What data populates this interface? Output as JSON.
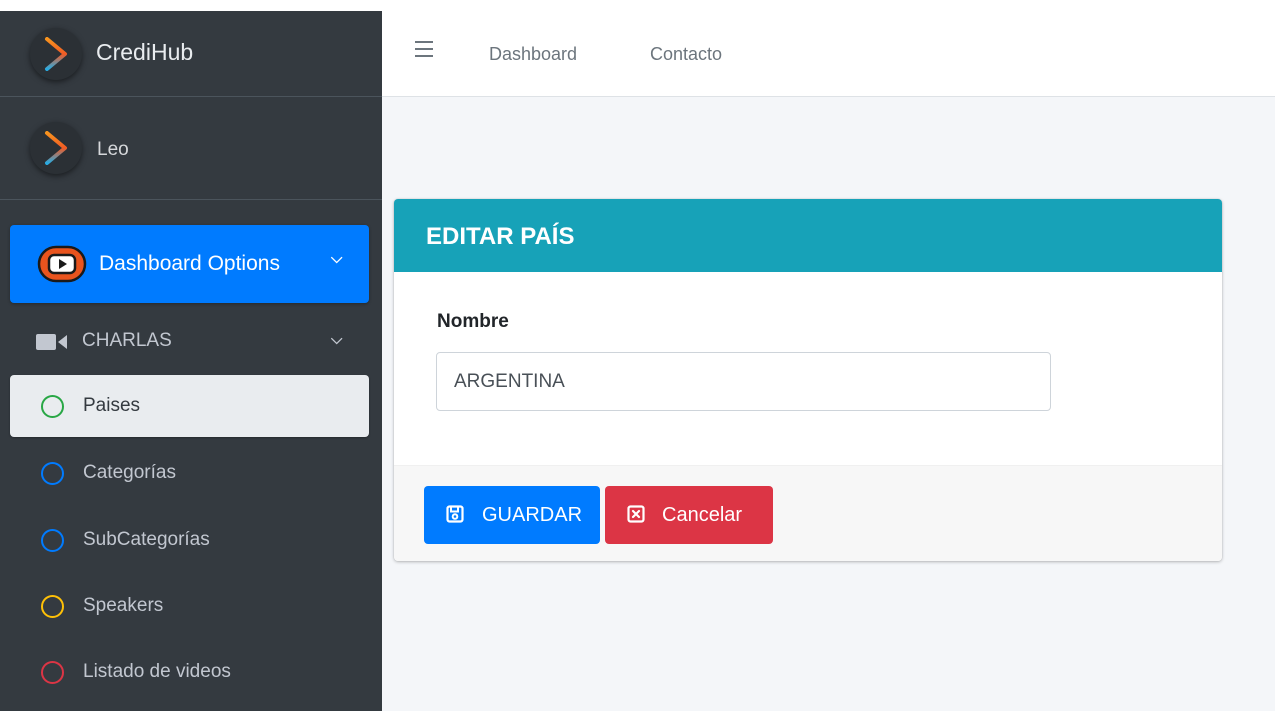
{
  "brand": {
    "name": "CrediHub",
    "logo_icon": "chevron-logo-icon"
  },
  "user": {
    "name": "Leo"
  },
  "sidebar": {
    "main_menu": {
      "label": "Dashboard Options",
      "icon": "youtube-icon"
    },
    "section": {
      "label": "CHARLAS",
      "icon": "video-camera-icon"
    },
    "items": [
      {
        "label": "Paises",
        "circle_color": "#28a745",
        "active": true
      },
      {
        "label": "Categorías",
        "circle_color": "#007bff",
        "active": false
      },
      {
        "label": "SubCategorías",
        "circle_color": "#007bff",
        "active": false
      },
      {
        "label": "Speakers",
        "circle_color": "#ffc107",
        "active": false
      },
      {
        "label": "Listado de videos",
        "circle_color": "#dc3545",
        "active": false
      }
    ]
  },
  "navbar": {
    "menu_icon": "hamburger-icon",
    "links": [
      "Dashboard",
      "Contacto"
    ]
  },
  "card": {
    "title": "EDITAR PAÍS",
    "field_label": "Nombre",
    "field_value": "ARGENTINA",
    "save_label": "GUARDAR",
    "cancel_label": "Cancelar"
  },
  "colors": {
    "sidebar_bg": "#343a40",
    "primary": "#007bff",
    "info": "#17a2b8",
    "danger": "#dc3545",
    "content_bg": "#f4f6f9"
  }
}
